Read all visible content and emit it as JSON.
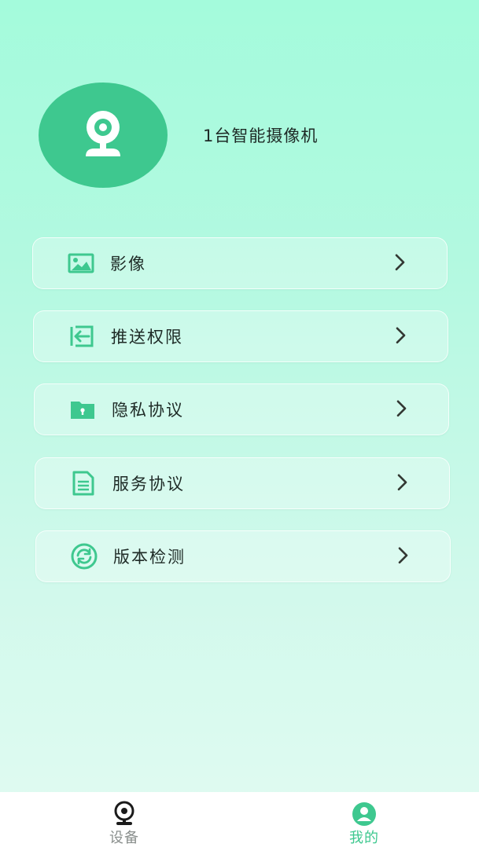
{
  "profile": {
    "device_count_text": "1台智能摄像机",
    "avatar_icon": "camera-icon"
  },
  "menu": {
    "items": [
      {
        "label": "影像",
        "icon": "image-icon"
      },
      {
        "label": "推送权限",
        "icon": "push-permission-icon"
      },
      {
        "label": "隐私协议",
        "icon": "privacy-folder-icon"
      },
      {
        "label": "服务协议",
        "icon": "document-icon"
      },
      {
        "label": "版本检测",
        "icon": "refresh-icon"
      }
    ]
  },
  "tabbar": {
    "tabs": [
      {
        "label": "设备",
        "icon": "webcam-icon",
        "active": false
      },
      {
        "label": "我的",
        "icon": "user-icon",
        "active": true
      }
    ]
  },
  "colors": {
    "accent": "#3ec88f",
    "background_top": "#a4fbdc",
    "background_bottom": "#e2fbf2",
    "tab_inactive": "#8a8f8d"
  }
}
